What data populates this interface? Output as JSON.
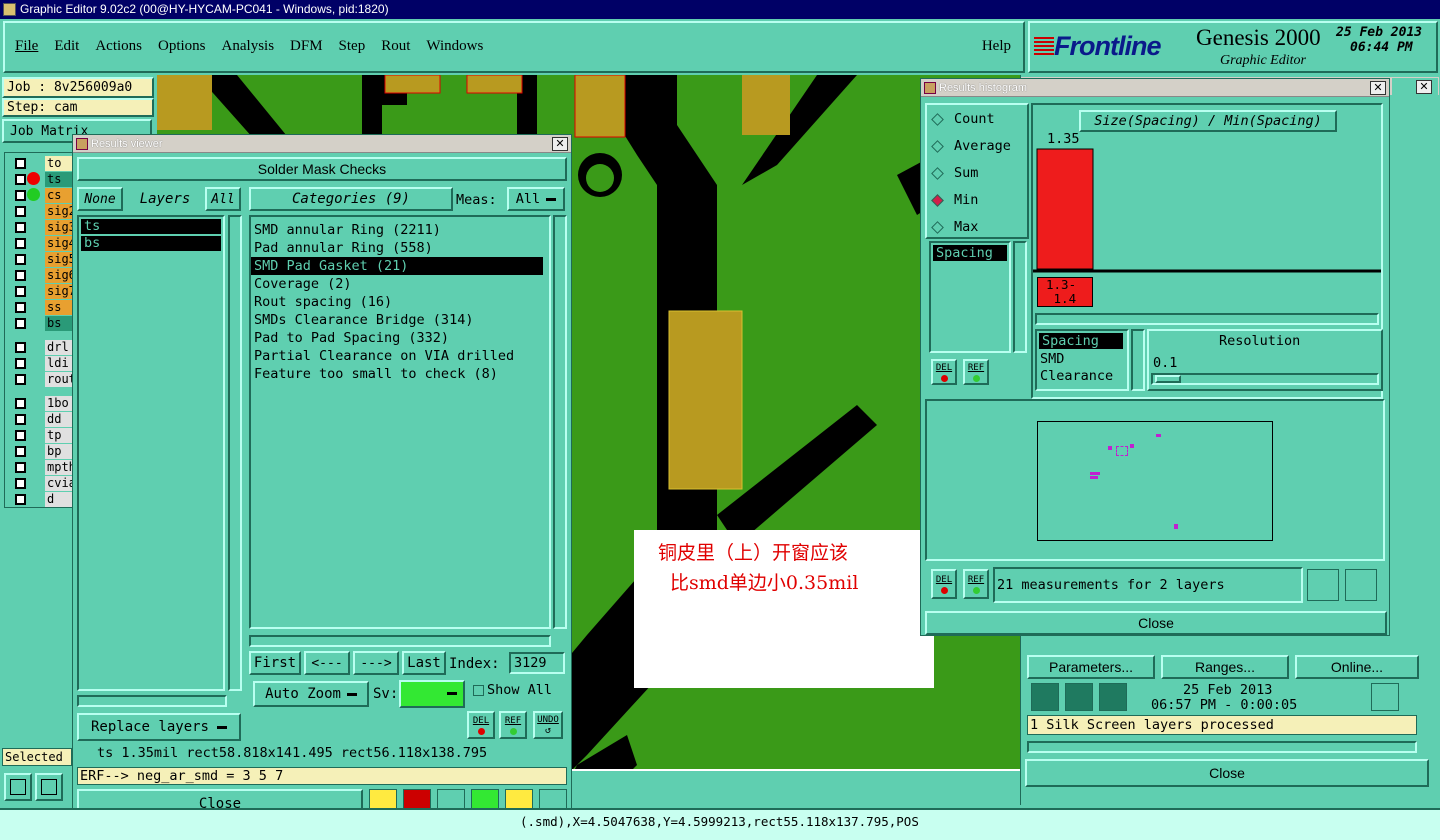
{
  "titlebar": {
    "title": "Graphic Editor 9.02c2 (00@HY-HYCAM-PC041 - Windows, pid:1820)"
  },
  "menu": {
    "items": [
      "File",
      "Edit",
      "Actions",
      "Options",
      "Analysis",
      "DFM",
      "Step",
      "Rout",
      "Windows"
    ],
    "help": "Help"
  },
  "brand": {
    "logo": "Frontline",
    "product": "Genesis 2000",
    "subtitle": "Graphic Editor",
    "date": "25 Feb 2013",
    "time": "06:44 PM"
  },
  "job": {
    "job_label": "Job : 8v256009a0",
    "step_label": "Step: cam",
    "matrix_label": "Job Matrix"
  },
  "layers": [
    {
      "name": "to",
      "color": "#f5f0b8"
    },
    {
      "name": "ts",
      "color": "#2a9a78"
    },
    {
      "name": "cs",
      "color": "#e8a030"
    },
    {
      "name": "sig2",
      "color": "#e8a030"
    },
    {
      "name": "sig3",
      "color": "#e8a030"
    },
    {
      "name": "sig4",
      "color": "#e8a030"
    },
    {
      "name": "sig5",
      "color": "#e8a030"
    },
    {
      "name": "sig6",
      "color": "#e8a030"
    },
    {
      "name": "sig7",
      "color": "#e8a030"
    },
    {
      "name": "ss",
      "color": "#e8a030"
    },
    {
      "name": "bs",
      "color": "#2a9a78"
    },
    {
      "name": "drl",
      "color": "#e0e0e0"
    },
    {
      "name": "ldi",
      "color": "#e0e0e0"
    },
    {
      "name": "rout",
      "color": "#e0e0e0"
    },
    {
      "name": "1bo",
      "color": "#e0e0e0"
    },
    {
      "name": "dd",
      "color": "#e0e0e0"
    },
    {
      "name": "tp",
      "color": "#e0e0e0"
    },
    {
      "name": "bp",
      "color": "#e0e0e0"
    },
    {
      "name": "mpth",
      "color": "#e0e0e0"
    },
    {
      "name": "cvia",
      "color": "#e0e0e0"
    },
    {
      "name": "d",
      "color": "#e0e0e0"
    }
  ],
  "selected_label": "Selected",
  "results_viewer": {
    "title": "Results viewer",
    "header": "Solder Mask Checks",
    "none_btn": "None",
    "layers_label": "Layers",
    "all_btn": "All",
    "categories_label": "Categories (9)",
    "meas_label": "Meas:",
    "meas_value": "All",
    "layer_list": [
      "ts",
      "bs"
    ],
    "categories": [
      "SMD annular Ring (2211)",
      "Pad annular Ring (558)",
      "SMD Pad Gasket (21)",
      "Coverage (2)",
      "Rout spacing (16)",
      "SMDs Clearance Bridge (314)",
      "Pad to Pad Spacing (332)",
      "Partial Clearance on VIA drilled",
      "Feature too small to check (8)"
    ],
    "selected_category": "SMD Pad Gasket (21)",
    "first": "First",
    "prev": "<---",
    "next": "--->",
    "last": "Last",
    "index_label": "Index:",
    "index_value": "3129",
    "auto_zoom": "Auto Zoom",
    "sv_label": "Sv:",
    "show_all": "Show All",
    "replace_layers": "Replace layers",
    "del": "DEL",
    "ref": "REF",
    "undo": "UNDO",
    "status": "ts 1.35mil   rect58.818x141.495  rect56.118x138.795",
    "erf": "ERF--> neg_ar_smd = 3 5 7",
    "close": "Close"
  },
  "histogram": {
    "title": "Results histogram",
    "modes": [
      "Count",
      "Average",
      "Sum",
      "Min",
      "Max"
    ],
    "selected_mode": "Min",
    "chart_title": "Size(Spacing) / Min(Spacing)",
    "bar_value": "1.35",
    "bar_range": "1.3-\n 1.4",
    "attr_list": [
      "Spacing"
    ],
    "attr_list2": [
      "Spacing",
      "SMD",
      "Clearance"
    ],
    "resolution_label": "Resolution",
    "resolution_value": "0.1",
    "del": "DEL",
    "ref": "REF",
    "measurements": "21 measurements for 2 layers",
    "close": "Close"
  },
  "right_panel": {
    "parameters": "Parameters...",
    "ranges": "Ranges...",
    "online": "Online...",
    "date": "25 Feb 2013",
    "time": "06:57 PM - 0:00:05",
    "log": "1 Silk Screen layers processed",
    "close": "Close"
  },
  "annotation": {
    "line1": "铜皮里（上）开窗应该",
    "line2": "比smd单边小0.35mil"
  },
  "bottom_status": "(.smd),X=4.5047638,Y=4.5999213,rect55.118x137.795,POS"
}
